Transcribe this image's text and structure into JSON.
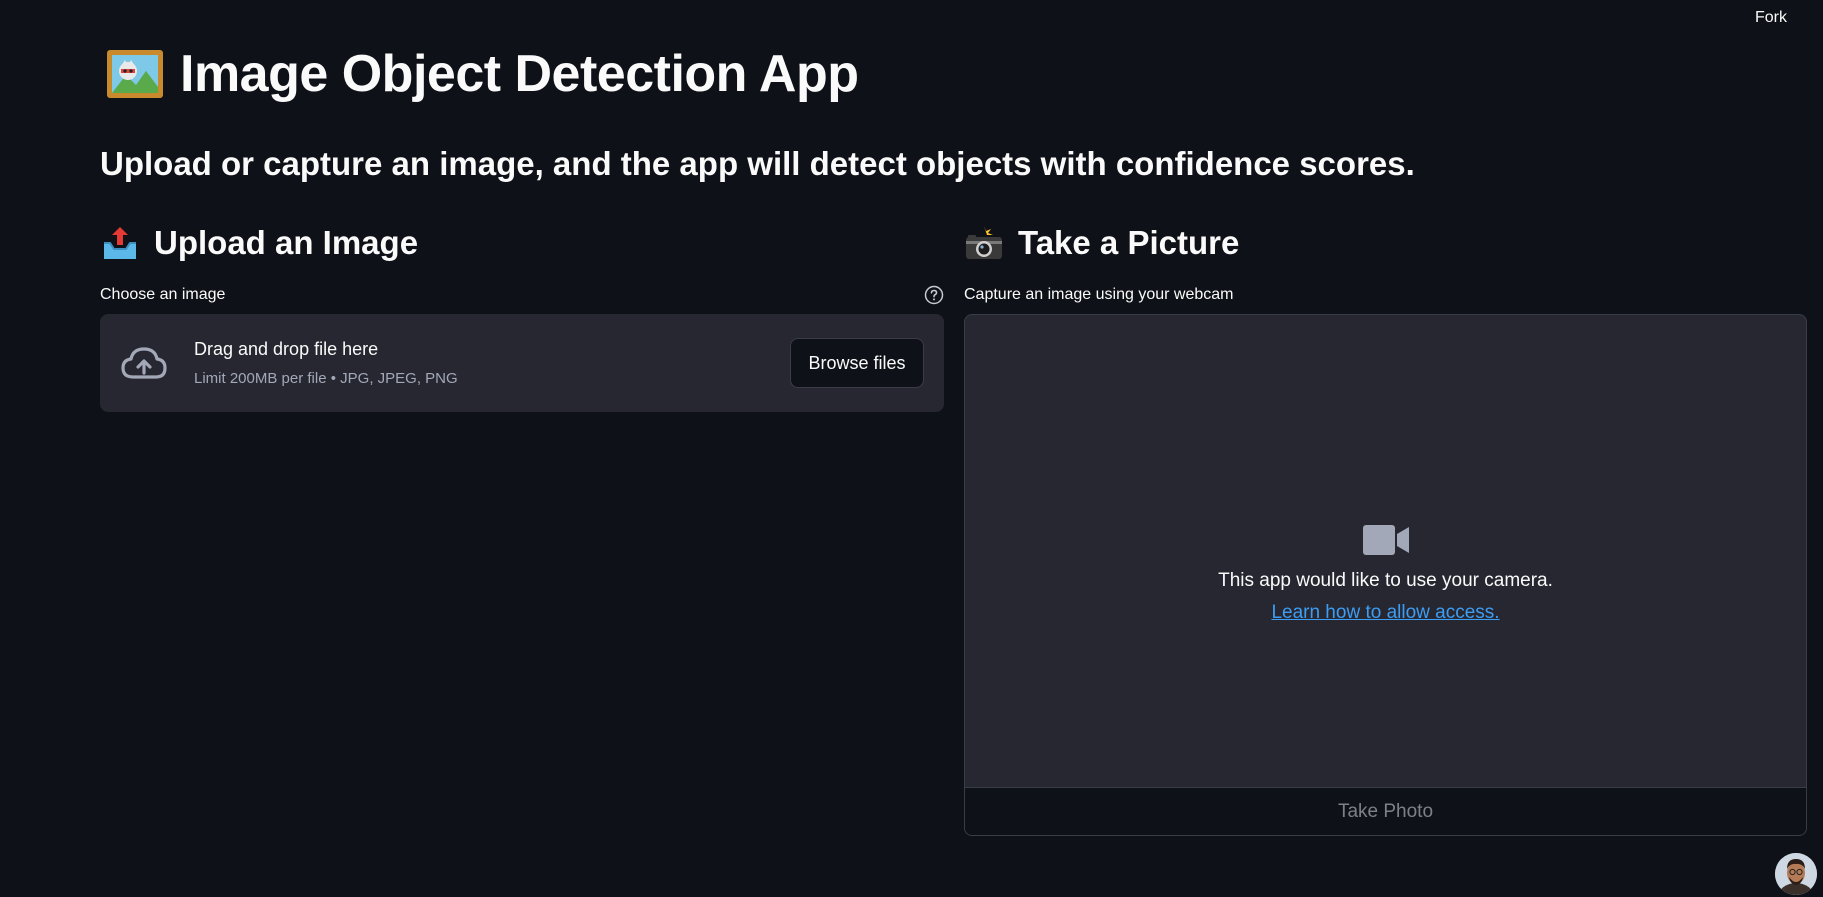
{
  "header": {
    "fork_label": "Fork"
  },
  "page": {
    "title": "Image Object Detection App",
    "subtitle": "Upload or capture an image, and the app will detect objects with confidence scores."
  },
  "upload": {
    "heading": "Upload an Image",
    "label": "Choose an image",
    "drag_text": "Drag and drop file here",
    "limit_text": "Limit 200MB per file • JPG, JPEG, PNG",
    "browse_label": "Browse files"
  },
  "camera": {
    "heading": "Take a Picture",
    "label": "Capture an image using your webcam",
    "message": "This app would like to use your camera.",
    "link_text": "Learn how to allow access.",
    "take_photo_label": "Take Photo"
  },
  "icons": {
    "title": "framed-picture-icon",
    "upload": "outbox-tray-icon",
    "camera": "camera-with-flash-icon",
    "help": "question-circle-icon",
    "dropzone": "cloud-upload-icon",
    "video": "video-camera-icon"
  },
  "colors": {
    "background": "#0e1117",
    "surface": "#262730",
    "link": "#3d9df3",
    "muted_text": "#a3a8b8"
  }
}
